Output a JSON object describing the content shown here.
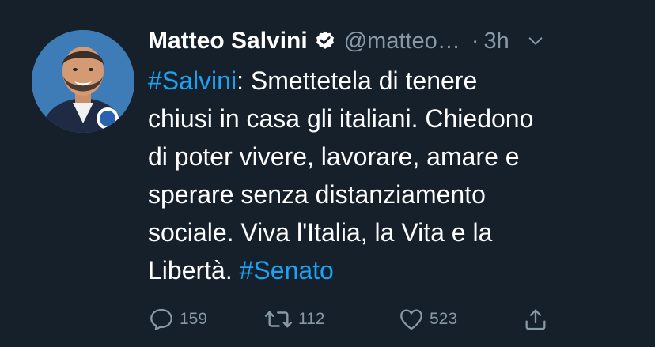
{
  "tweet": {
    "author_name": "Matteo Salvini",
    "handle": "@matteo…",
    "separator": "·",
    "time": "3h",
    "body_lines": [
      {
        "hashtag": "#Salvini",
        "text": ": Smettetela di tenere"
      },
      {
        "text": "chiusi in casa gli italiani. Chiedono"
      },
      {
        "text": "di poter vivere, lavorare, amare e"
      },
      {
        "text": "sperare senza distanziamento"
      },
      {
        "text": "sociale. Viva l'Italia, la Vita e la"
      },
      {
        "text": "Libertà. ",
        "hashtag_end": "#Senato"
      }
    ]
  },
  "actions": {
    "reply_count": "159",
    "retweet_count": "112",
    "like_count": "523"
  },
  "colors": {
    "background": "#15202b",
    "text": "#ffffff",
    "secondary": "#8899a6",
    "link": "#1da1f2"
  },
  "icons": {
    "verified": "verified-badge-icon",
    "more": "chevron-down-icon",
    "reply": "reply-icon",
    "retweet": "retweet-icon",
    "like": "heart-icon",
    "share": "share-icon"
  }
}
